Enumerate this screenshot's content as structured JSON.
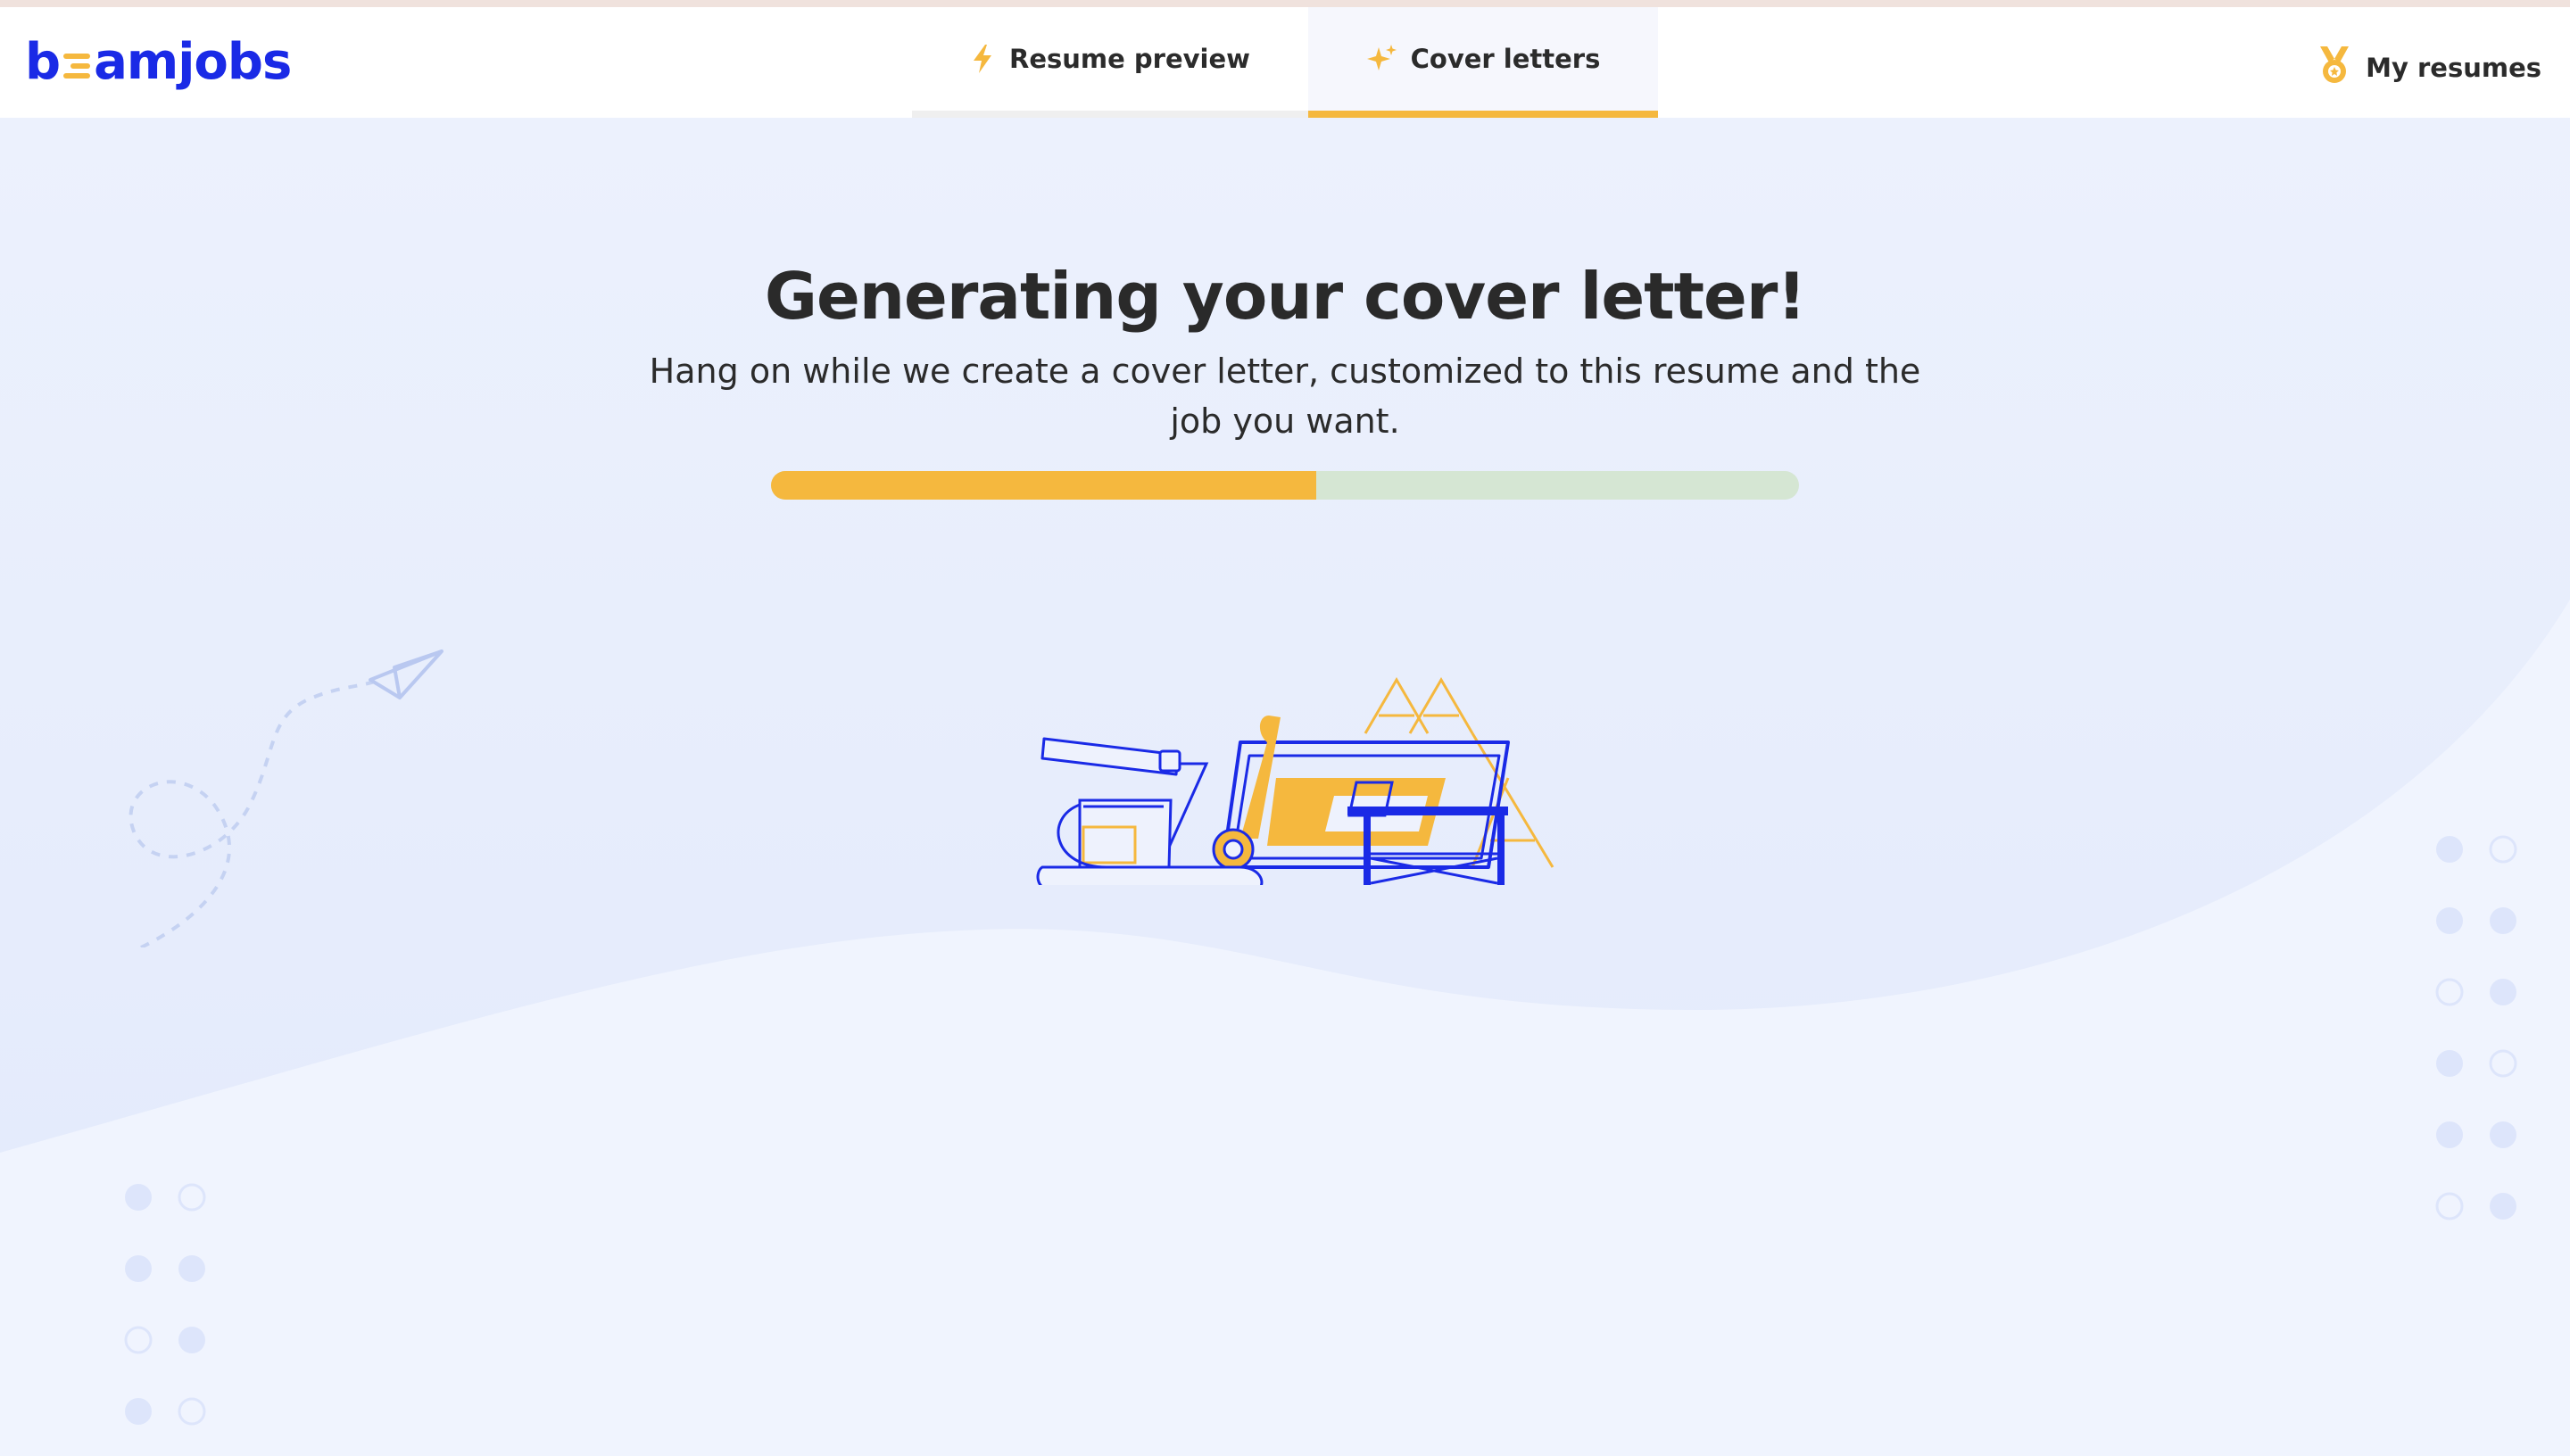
{
  "brand": {
    "logo_text_before": "b",
    "logo_text_after": "amjobs",
    "primary_color": "#1a2ae6",
    "accent_color": "#f5b83e"
  },
  "nav": {
    "tabs": [
      {
        "label": "Resume preview",
        "icon": "lightning-icon",
        "active": false
      },
      {
        "label": "Cover letters",
        "icon": "sparkle-icon",
        "active": true
      }
    ],
    "my_resumes": {
      "label": "My resumes",
      "icon": "medal-icon"
    }
  },
  "main": {
    "title": "Generating your cover letter!",
    "subtitle": "Hang on while we create a cover letter, customized to this resume and the job you want.",
    "progress": {
      "value": 0.53,
      "fill_color": "#f5b83e",
      "track_color": "#d5e6d3"
    }
  }
}
